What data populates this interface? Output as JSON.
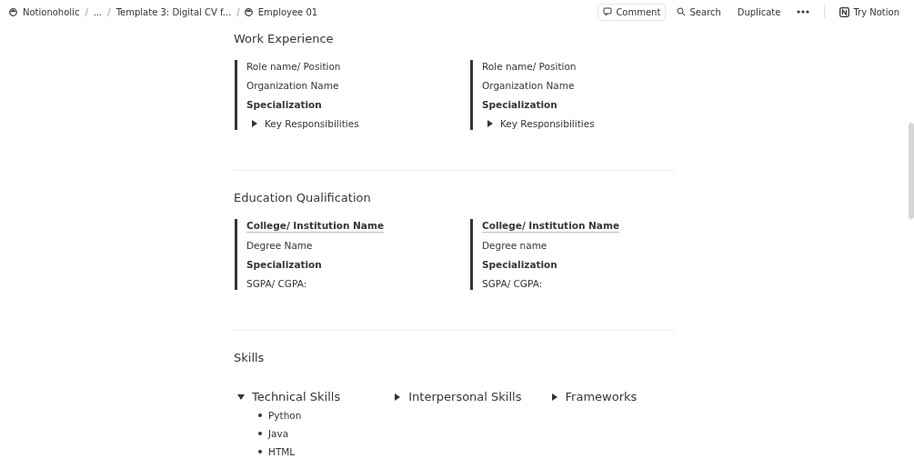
{
  "topbar": {
    "breadcrumbs": [
      {
        "label": "Notionoholic",
        "icon": true
      },
      {
        "separator": "/",
        "label": "..."
      },
      {
        "separator": "/",
        "label": "Template 3: Digital CV f..."
      },
      {
        "separator": "/",
        "label": "Employee 01",
        "icon": true
      }
    ],
    "actions": [
      {
        "kind": "comment",
        "label": "Comment"
      },
      {
        "kind": "search",
        "label": "Search"
      },
      {
        "kind": "plain",
        "label": "Duplicate"
      },
      {
        "kind": "more"
      }
    ],
    "try_button": "Try Notion"
  },
  "sections": [
    {
      "title": "Work Experience",
      "columns": [
        [
          {
            "kind": "text",
            "text": "Role name/ Position"
          },
          {
            "kind": "text",
            "text": "Organization Name"
          },
          {
            "kind": "bold",
            "text": "Specialization"
          },
          {
            "kind": "toggle",
            "text": "Key Responsibilities",
            "expanded": false
          }
        ],
        [
          {
            "kind": "text",
            "text": "Role name/ Position"
          },
          {
            "kind": "text",
            "text": "Organization Name"
          },
          {
            "kind": "bold",
            "text": "Specialization"
          },
          {
            "kind": "toggle",
            "text": "Key Responsibilities",
            "expanded": false
          }
        ]
      ]
    },
    {
      "title": "Education Qualification",
      "columns": [
        [
          {
            "kind": "link",
            "text": "College/ Institution Name"
          },
          {
            "kind": "text",
            "text": "Degree Name"
          },
          {
            "kind": "bold",
            "text": "Specialization"
          },
          {
            "kind": "text",
            "text": "SGPA/ CGPA:"
          }
        ],
        [
          {
            "kind": "link",
            "text": "College/ Institution Name"
          },
          {
            "kind": "text",
            "text": "Degree name"
          },
          {
            "kind": "bold",
            "text": "Specialization"
          },
          {
            "kind": "text",
            "text": "SGPA/ CGPA:"
          }
        ]
      ]
    }
  ],
  "skills": {
    "title": "Skills",
    "groups": [
      {
        "label": "Technical Skills",
        "expanded": true,
        "items": [
          "Python",
          "Java",
          "HTML"
        ]
      },
      {
        "label": "Interpersonal Skills",
        "expanded": false
      },
      {
        "label": "Frameworks",
        "expanded": false
      }
    ]
  }
}
